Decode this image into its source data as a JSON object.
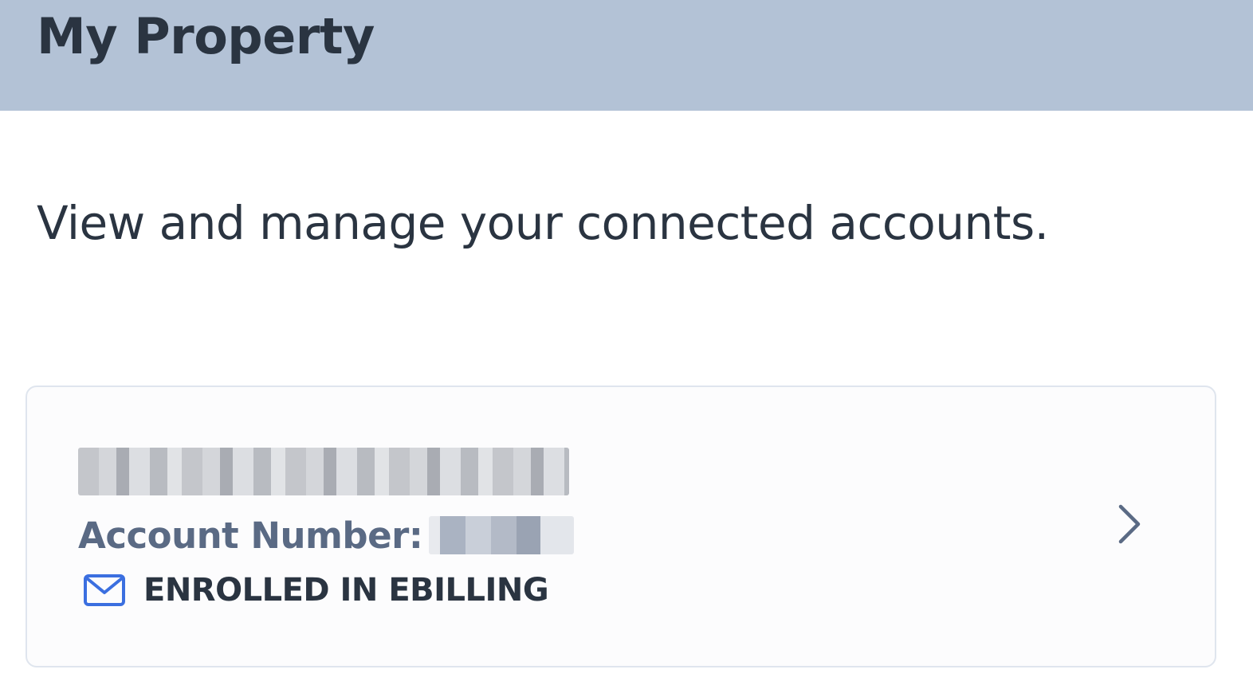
{
  "header": {
    "title": "My Property",
    "background_color": "#b3c2d6"
  },
  "intro": {
    "text": "View and manage your connected accounts."
  },
  "account_card": {
    "account_number_label": "Account Number:",
    "ebilling_status": "ENROLLED IN EBILLING",
    "status_icon": "mail-icon",
    "nav_icon": "chevron-right-icon",
    "icon_accent_color": "#3b6fe0"
  }
}
